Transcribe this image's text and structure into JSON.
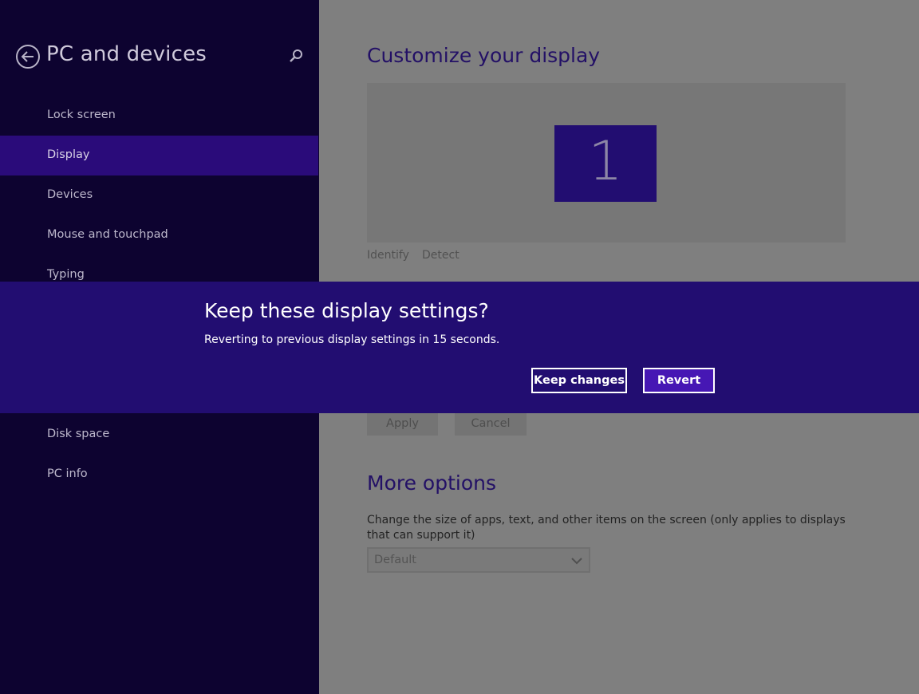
{
  "sidebar": {
    "title": "PC and devices",
    "back_icon": "back-arrow-circle-icon",
    "search_icon": "search-icon",
    "items": [
      {
        "label": "Lock screen",
        "selected": false
      },
      {
        "label": "Display",
        "selected": true
      },
      {
        "label": "Devices",
        "selected": false
      },
      {
        "label": "Mouse and touchpad",
        "selected": false
      },
      {
        "label": "Typing",
        "selected": false
      },
      {
        "label": "Disk space",
        "selected": false
      },
      {
        "label": "PC info",
        "selected": false
      }
    ]
  },
  "main": {
    "heading": "Customize your display",
    "monitor_number": "1",
    "identify_label": "Identify",
    "detect_label": "Detect",
    "apply_label": "Apply",
    "cancel_label": "Cancel",
    "more_heading": "More options",
    "more_description": "Change the size of apps, text, and other items on the screen (only applies to displays that can support it)",
    "size_select_value": "Default"
  },
  "dialog": {
    "title": "Keep these display settings?",
    "message": "Reverting to previous display settings in 15 seconds.",
    "keep_label": "Keep changes",
    "revert_label": "Revert"
  },
  "colors": {
    "sidebar_bg": "#0d0330",
    "accent": "#220d71",
    "selected_item": "#2a0b7a",
    "revert_button": "#4617b4",
    "dimmed_overlay": "#7f7f7f"
  }
}
